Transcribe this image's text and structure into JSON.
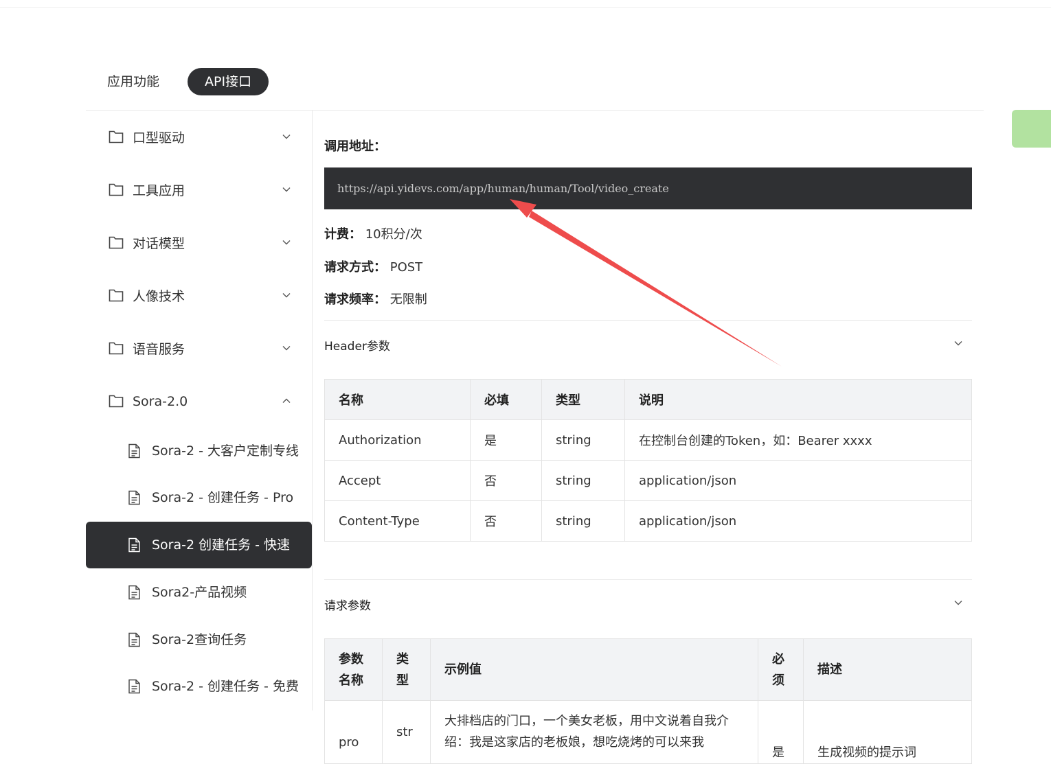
{
  "tabs": [
    {
      "label": "应用功能",
      "active": false
    },
    {
      "label": "API接口",
      "active": true
    }
  ],
  "sidebar": {
    "folders": [
      {
        "label": "口型驱动",
        "expanded": false
      },
      {
        "label": "工具应用",
        "expanded": false
      },
      {
        "label": "对话模型",
        "expanded": false
      },
      {
        "label": "人像技术",
        "expanded": false
      },
      {
        "label": "语音服务",
        "expanded": false
      },
      {
        "label": "Sora-2.0",
        "expanded": true
      }
    ],
    "docs": [
      {
        "label": "Sora-2 - 大客户定制专线",
        "active": false
      },
      {
        "label": "Sora-2 - 创建任务 - Pro",
        "active": false
      },
      {
        "label": "Sora-2 创建任务 - 快速",
        "active": true
      },
      {
        "label": "Sora2-产品视频",
        "active": false
      },
      {
        "label": "Sora-2查询任务",
        "active": false
      },
      {
        "label": "Sora-2 - 创建任务 - 免费",
        "active": false
      }
    ]
  },
  "main": {
    "url_title": "调用地址：",
    "url": "https://api.yidevs.com/app/human/human/Tool/video_create",
    "billing_label": "计费：",
    "billing_value": "10积分/次",
    "method_label": "请求方式：",
    "method_value": "POST",
    "rate_label": "请求频率：",
    "rate_value": "无限制",
    "header_section": {
      "title": "Header参数",
      "columns": [
        "名称",
        "必填",
        "类型",
        "说明"
      ],
      "rows": [
        [
          "Authorization",
          "是",
          "string",
          "在控制台创建的Token，如：Bearer xxxx"
        ],
        [
          "Accept",
          "否",
          "string",
          "application/json"
        ],
        [
          "Content-Type",
          "否",
          "string",
          "application/json"
        ]
      ]
    },
    "request_section": {
      "title": "请求参数",
      "columns": [
        "参数名称",
        "类型",
        "示例值",
        "必须",
        "描述"
      ],
      "rows": [
        [
          "pro",
          "str",
          "大排档店的门口，一个美女老板，用中文说着自我介绍：我是这家店的老板娘，想吃烧烤的可以来我",
          "是",
          "生成视频的提示词"
        ]
      ]
    }
  },
  "colors": {
    "active_bg": "#2f3033",
    "side_tab": "#b2e2a0",
    "arrow": "#ee4c4c"
  }
}
